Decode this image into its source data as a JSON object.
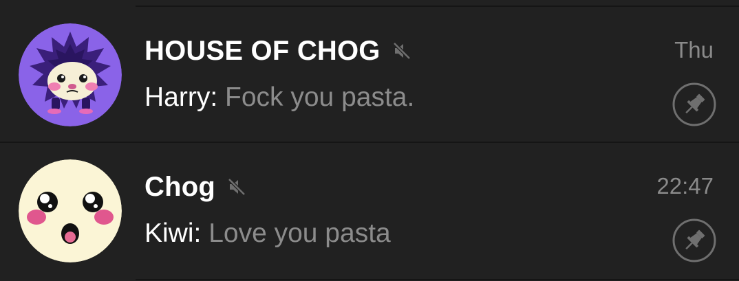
{
  "chats": [
    {
      "name": "HOUSE OF CHOG",
      "time": "Thu",
      "sender": "Harry:",
      "message": "Fock you pasta.",
      "muted": true,
      "pinned": true,
      "avatar_icon": "purple-spiky-chog-avatar"
    },
    {
      "name": "Chog",
      "time": "22:47",
      "sender": "Kiwi:",
      "message": "Love you pasta",
      "muted": true,
      "pinned": true,
      "avatar_icon": "cream-face-chog-avatar"
    }
  ],
  "colors": {
    "background": "#212121",
    "divider": "#151515",
    "title": "#ffffff",
    "secondary_text": "#8c8c8c",
    "icon_gray": "#6f6f6f",
    "avatar_purple": "#8a63e8",
    "avatar_cream": "#fbf5d6"
  }
}
